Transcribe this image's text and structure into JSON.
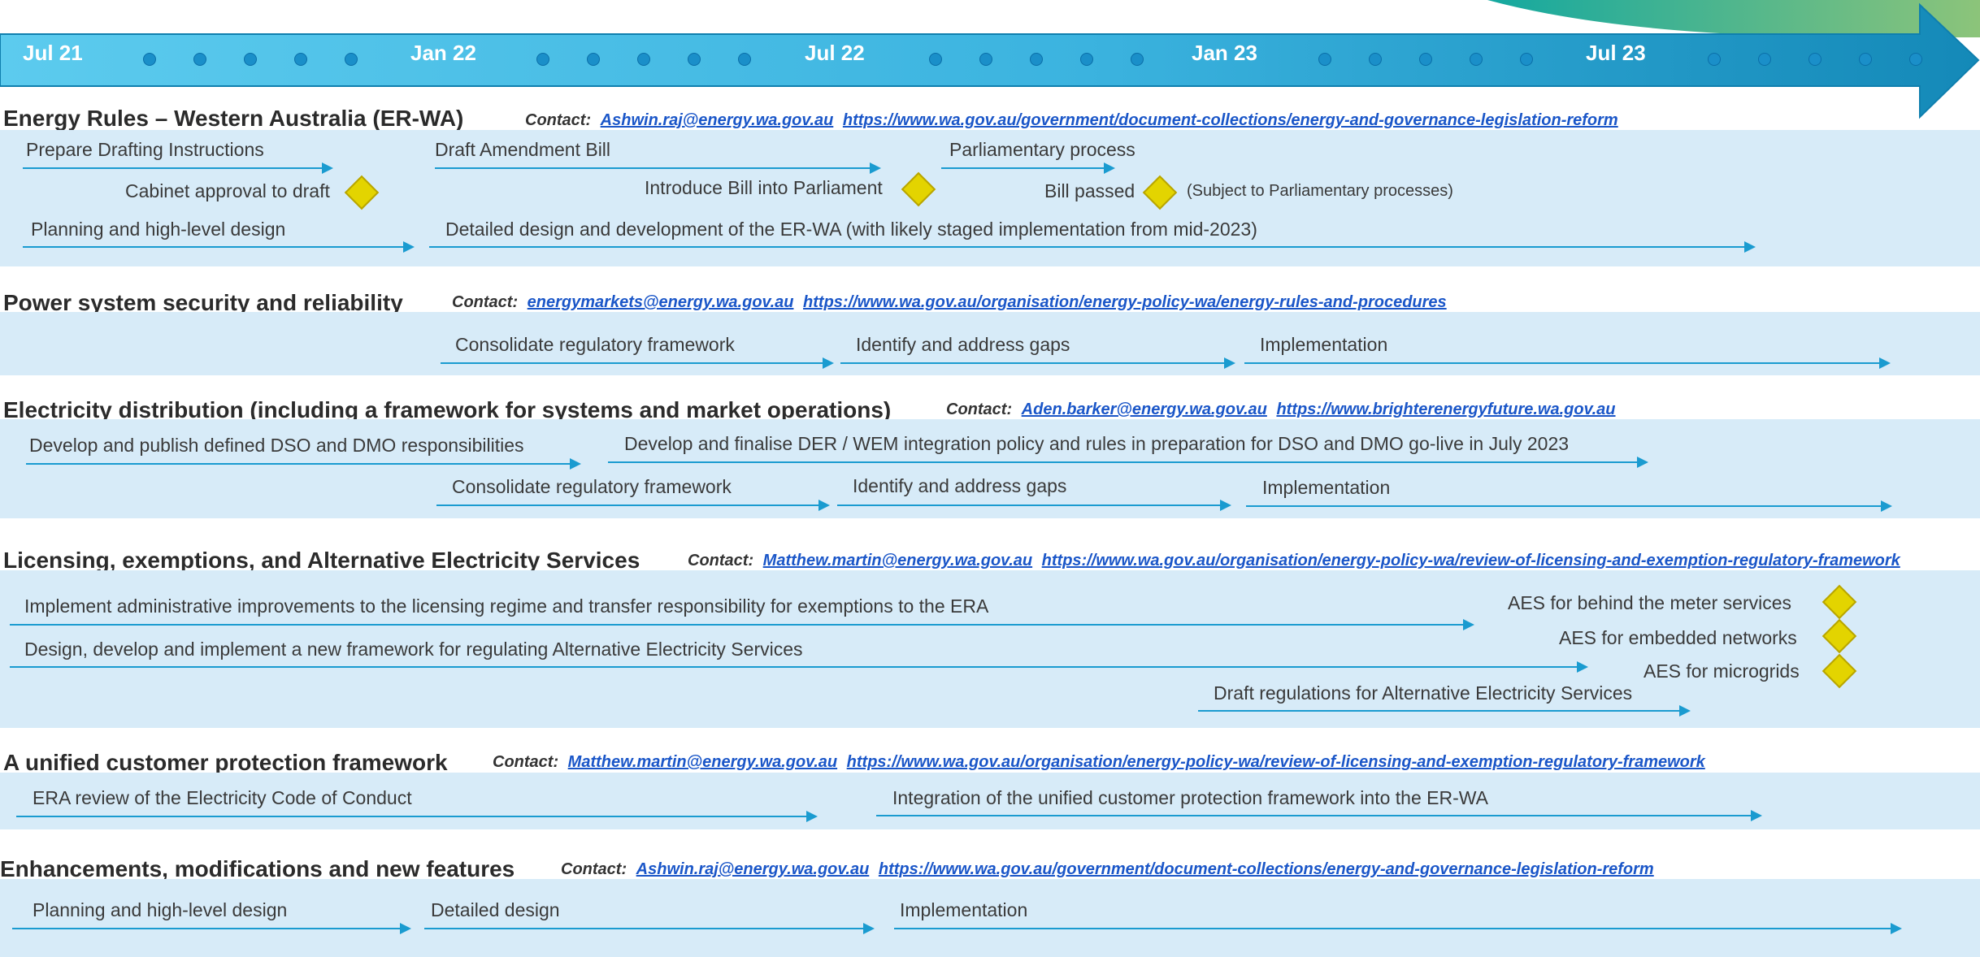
{
  "timeline": {
    "labels": [
      "Jul 21",
      "Jan 22",
      "Jul 22",
      "Jan 23",
      "Jul 23"
    ]
  },
  "sections": {
    "erwa": {
      "title": "Energy Rules – Western Australia (ER-WA)",
      "contact_label": "Contact:",
      "email": "Ashwin.raj@energy.wa.gov.au",
      "url": "https://www.wa.gov.au/government/document-collections/energy-and-governance-legislation-reform",
      "tasks": [
        "Prepare Drafting Instructions",
        "Draft Amendment Bill",
        "Parliamentary process",
        "Planning and high-level design",
        "Detailed design and development of the ER-WA (with likely staged implementation from mid-2023)"
      ],
      "milestones": [
        "Cabinet approval to draft",
        "Introduce Bill into Parliament",
        "Bill passed"
      ],
      "note": "(Subject to Parliamentary processes)"
    },
    "security": {
      "title": "Power system security and reliability",
      "contact_label": "Contact:",
      "email": "energymarkets@energy.wa.gov.au",
      "url": "https://www.wa.gov.au/organisation/energy-policy-wa/energy-rules-and-procedures",
      "tasks": [
        "Consolidate regulatory framework",
        "Identify and address gaps",
        "Implementation"
      ]
    },
    "distribution": {
      "title": "Electricity distribution (including a framework for systems and market operations)",
      "contact_label": "Contact:",
      "email": "Aden.barker@energy.wa.gov.au",
      "url": "https://www.brighterenergyfuture.wa.gov.au",
      "tasks": [
        "Develop and publish defined DSO and DMO responsibilities",
        "Develop and finalise DER / WEM integration policy and rules in preparation for DSO and DMO go-live in July 2023",
        "Consolidate regulatory framework",
        "Identify and address gaps",
        "Implementation"
      ]
    },
    "licensing": {
      "title": "Licensing, exemptions, and Alternative Electricity Services",
      "contact_label": "Contact:",
      "email": "Matthew.martin@energy.wa.gov.au",
      "url": "https://www.wa.gov.au/organisation/energy-policy-wa/review-of-licensing-and-exemption-regulatory-framework",
      "tasks": [
        "Implement administrative improvements to the licensing regime and transfer responsibility for exemptions to the ERA",
        "Design, develop and implement a new framework for regulating Alternative Electricity Services",
        "Draft regulations for Alternative Electricity Services"
      ],
      "milestones": [
        "AES for behind the meter services",
        "AES for embedded networks",
        "AES for microgrids"
      ]
    },
    "customer": {
      "title": "A unified customer protection framework",
      "contact_label": "Contact:",
      "email": "Matthew.martin@energy.wa.gov.au",
      "url": "https://www.wa.gov.au/organisation/energy-policy-wa/review-of-licensing-and-exemption-regulatory-framework",
      "tasks": [
        "ERA review of the Electricity Code of Conduct",
        "Integration of the unified customer protection framework into the ER-WA"
      ]
    },
    "enhancements": {
      "title": "Enhancements, modifications and new features",
      "contact_label": "Contact:",
      "email": "Ashwin.raj@energy.wa.gov.au",
      "url": "https://www.wa.gov.au/government/document-collections/energy-and-governance-legislation-reform",
      "tasks": [
        "Planning and high-level design",
        "Detailed design",
        "Implementation"
      ]
    }
  },
  "colors": {
    "band": "#d7ebf8",
    "arrow": "#1a9bd0",
    "milestone": "#e3d400",
    "timeline_light": "#5ccbee",
    "timeline_dark": "#1489b8",
    "link": "#1a56c8"
  }
}
